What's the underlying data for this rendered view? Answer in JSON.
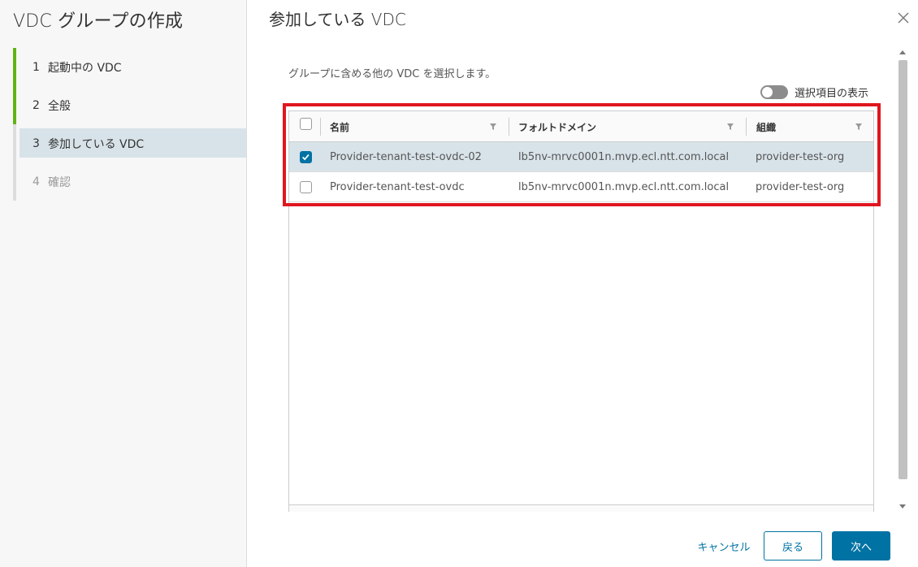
{
  "wizard": {
    "title": "VDC グループの作成",
    "steps": [
      {
        "num": "1",
        "label": "起動中の VDC"
      },
      {
        "num": "2",
        "label": "全般"
      },
      {
        "num": "3",
        "label": "参加している VDC"
      },
      {
        "num": "4",
        "label": "確認"
      }
    ]
  },
  "main": {
    "title": "参加している VDC",
    "description": "グループに含める他の VDC を選択します。",
    "toggle_label": "選択項目の表示"
  },
  "grid": {
    "columns": [
      "名前",
      "フォルトドメイン",
      "組織"
    ],
    "rows": [
      {
        "name": "Provider-tenant-test-ovdc-02",
        "fault_domain": "lb5nv-mrvc0001n.mvp.ecl.ntt.com.local",
        "org": "provider-test-org",
        "checked": true
      },
      {
        "name": "Provider-tenant-test-ovdc",
        "fault_domain": "lb5nv-mrvc0001n.mvp.ecl.ntt.com.local",
        "org": "provider-test-org",
        "checked": false
      }
    ]
  },
  "buttons": {
    "cancel": "キャンセル",
    "back": "戻る",
    "next": "次へ"
  },
  "colors": {
    "accent": "#0072a3",
    "step_done": "#60b515",
    "highlight": "#e0161f",
    "selected_row": "#d8e3e9"
  }
}
